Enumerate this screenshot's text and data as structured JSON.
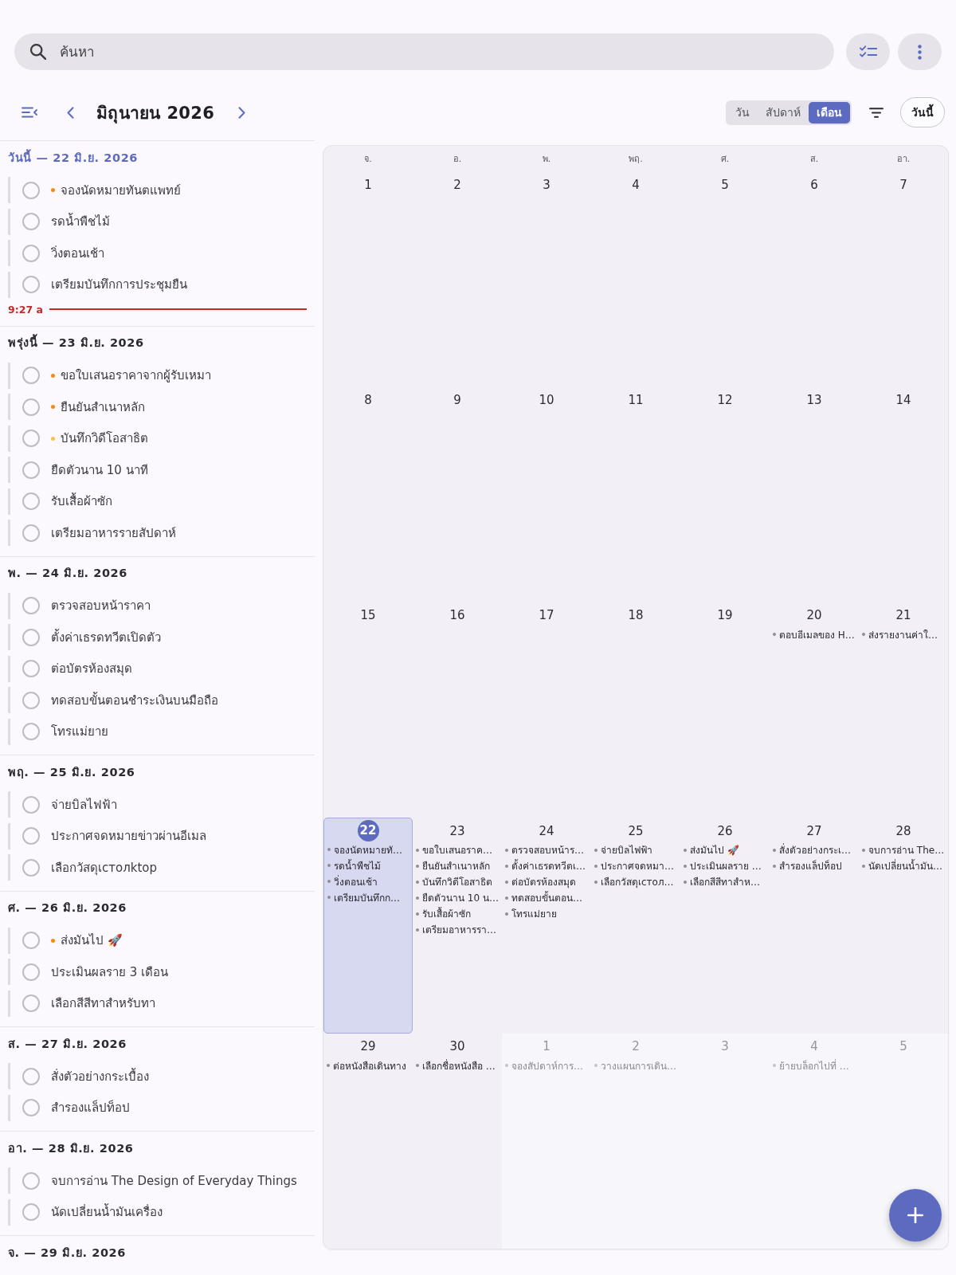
{
  "search": {
    "placeholder": "ค้นหา"
  },
  "toolbar": {
    "title": "มิถุนายน 2026",
    "view_tabs": [
      {
        "label": "วัน",
        "selected": false
      },
      {
        "label": "สัปดาห์",
        "selected": false
      },
      {
        "label": "เดือน",
        "selected": true
      }
    ],
    "today_button": "วันนี้"
  },
  "agenda": [
    {
      "heading": "วันนี้ — 22 มิ.ย. 2026",
      "today": true,
      "tasks": [
        {
          "title": "จองนัดหมายทันตแพทย์",
          "checked": false,
          "color": "#f28c0f"
        },
        {
          "title": "รดน้ำพืชไม้",
          "checked": false
        },
        {
          "title": "วิ่งตอนเช้า",
          "checked": false
        },
        {
          "title": "เตรียมบันทึกการประชุมยืน",
          "checked": false
        }
      ],
      "now_marker": "9:27 a"
    },
    {
      "heading": "พรุ่งนี้ — 23 มิ.ย. 2026",
      "today": false,
      "tasks": [
        {
          "title": "ขอใบเสนอราคาจากผู้รับเหมา",
          "checked": false,
          "color": "#f28c0f"
        },
        {
          "title": "ยืนยันสำเนาหลัก",
          "checked": false,
          "color": "#f28c0f"
        },
        {
          "title": "บันทึกวิดีโอสาธิต",
          "checked": false,
          "color": "#f6c342"
        },
        {
          "title": "ยืดตัวนาน 10 นาที",
          "checked": false
        },
        {
          "title": "รับเสื้อผ้าซัก",
          "checked": false
        },
        {
          "title": "เตรียมอาหารรายสัปดาห์",
          "checked": false
        }
      ]
    },
    {
      "heading": "พ. — 24 มิ.ย. 2026",
      "today": false,
      "tasks": [
        {
          "title": "ตรวจสอบหน้าราคา",
          "checked": false
        },
        {
          "title": "ตั้งค่าเธรดทวีตเปิดตัว",
          "checked": false
        },
        {
          "title": "ต่อบัตรห้องสมุด",
          "checked": false
        },
        {
          "title": "ทดสอบขั้นตอนชำระเงินบนมือถือ",
          "checked": false
        },
        {
          "title": "โทรแม่ยาย",
          "checked": false
        }
      ]
    },
    {
      "heading": "พฤ. — 25 มิ.ย. 2026",
      "today": false,
      "tasks": [
        {
          "title": "จ่ายบิลไฟฟ้า",
          "checked": false
        },
        {
          "title": "ประกาศจดหมายข่าวผ่านอีเมล",
          "checked": false
        },
        {
          "title": "เลือกวัสดุเстолktop",
          "checked": false
        }
      ]
    },
    {
      "heading": "ศ. — 26 มิ.ย. 2026",
      "today": false,
      "tasks": [
        {
          "title": "ส่งมันไป 🚀",
          "checked": false,
          "color": "#f28c0f"
        },
        {
          "title": "ประเมินผลราย 3 เดือน",
          "checked": false
        },
        {
          "title": "เลือกสีสีทาสำหรับทา",
          "checked": false
        }
      ]
    },
    {
      "heading": "ส. — 27 มิ.ย. 2026",
      "today": false,
      "tasks": [
        {
          "title": "สั่งตัวอย่างกระเบื้อง",
          "checked": false
        },
        {
          "title": "สำรองแล็ปท็อป",
          "checked": false
        }
      ]
    },
    {
      "heading": "อา. — 28 มิ.ย. 2026",
      "today": false,
      "tasks": [
        {
          "title": "จบการอ่าน The Design of Everyday Things",
          "checked": false
        },
        {
          "title": "นัดเปลี่ยนน้ำมันเครื่อง",
          "checked": false
        }
      ]
    },
    {
      "heading": "จ. — 29 มิ.ย. 2026",
      "today": false
    }
  ],
  "calendar": {
    "weekdays": [
      "จ.",
      "อ.",
      "พ.",
      "พฤ.",
      "ศ.",
      "ส.",
      "อา."
    ],
    "weeks": [
      {
        "days": [
          {
            "day": "1",
            "in_month": true,
            "selected": false,
            "today": false
          },
          {
            "day": "2",
            "in_month": true,
            "selected": false,
            "today": false
          },
          {
            "day": "3",
            "in_month": true,
            "selected": false,
            "today": false
          },
          {
            "day": "4",
            "in_month": true,
            "selected": false,
            "today": false
          },
          {
            "day": "5",
            "in_month": true,
            "selected": false,
            "today": false
          },
          {
            "day": "6",
            "in_month": true,
            "selected": false,
            "today": false
          },
          {
            "day": "7",
            "in_month": true,
            "selected": false,
            "today": false
          }
        ]
      },
      {
        "days": [
          {
            "day": "8",
            "in_month": true,
            "selected": false,
            "today": false
          },
          {
            "day": "9",
            "in_month": true,
            "selected": false,
            "today": false
          },
          {
            "day": "10",
            "in_month": true,
            "selected": false,
            "today": false
          },
          {
            "day": "11",
            "in_month": true,
            "selected": false,
            "today": false
          },
          {
            "day": "12",
            "in_month": true,
            "selected": false,
            "today": false
          },
          {
            "day": "13",
            "in_month": true,
            "selected": false,
            "today": false
          },
          {
            "day": "14",
            "in_month": true,
            "selected": false,
            "today": false
          }
        ]
      },
      {
        "days": [
          {
            "day": "15",
            "in_month": true,
            "selected": false,
            "today": false
          },
          {
            "day": "16",
            "in_month": true,
            "selected": false,
            "today": false
          },
          {
            "day": "17",
            "in_month": true,
            "selected": false,
            "today": false
          },
          {
            "day": "18",
            "in_month": true,
            "selected": false,
            "today": false
          },
          {
            "day": "19",
            "in_month": true,
            "selected": false,
            "today": false
          },
          {
            "day": "20",
            "in_month": true,
            "selected": false,
            "today": false,
            "events": [
              "ตอบอีเมลของ H…"
            ]
          },
          {
            "day": "21",
            "in_month": true,
            "selected": false,
            "today": false,
            "events": [
              "ส่งรายงานค่าใ…"
            ]
          }
        ]
      },
      {
        "days": [
          {
            "day": "22",
            "in_month": true,
            "selected": true,
            "today": true,
            "events": [
              "จองนัดหมายทั…",
              "รดน้ำพืชไม้",
              "วิ่งตอนเช้า",
              "เตรียมบันทึกก…"
            ]
          },
          {
            "day": "23",
            "in_month": true,
            "selected": false,
            "today": false,
            "events": [
              "ขอใบเสนอราค…",
              "ยืนยันสำเนาหลัก",
              "บันทึกวิดีโอสาธิต",
              "ยืดตัวนาน 10 น…",
              "รับเสื้อผ้าซัก",
              "เตรียมอาหารรา…"
            ]
          },
          {
            "day": "24",
            "in_month": true,
            "selected": false,
            "today": false,
            "events": [
              "ตรวจสอบหน้าร…",
              "ตั้งค่าเธรดทวีตเ…",
              "ต่อบัตรห้องสมุด",
              "ทดสอบขั้นตอน…",
              "โทรแม่ยาย"
            ]
          },
          {
            "day": "25",
            "in_month": true,
            "selected": false,
            "today": false,
            "events": [
              "จ่ายบิลไฟฟ้า",
              "ประกาศจดหมา…",
              "เลือกวัสดุเстол…"
            ]
          },
          {
            "day": "26",
            "in_month": true,
            "selected": false,
            "today": false,
            "events": [
              "ส่งมันไป 🚀",
              "ประเมินผลราย …",
              "เลือกสีสีทาสำห…"
            ]
          },
          {
            "day": "27",
            "in_month": true,
            "selected": false,
            "today": false,
            "events": [
              "สั่งตัวอย่างกระเ…",
              "สำรองแล็ปท็อป"
            ]
          },
          {
            "day": "28",
            "in_month": true,
            "selected": false,
            "today": false,
            "events": [
              "จบการอ่าน The…",
              "นัดเปลี่ยนน้ำมัน…"
            ]
          }
        ]
      },
      {
        "days": [
          {
            "day": "29",
            "in_month": true,
            "selected": false,
            "today": false,
            "events": [
              "ต่อหนังสือเดินทาง"
            ]
          },
          {
            "day": "30",
            "in_month": true,
            "selected": false,
            "today": false,
            "events": [
              "เลือกชื่อหนังสือ …"
            ]
          },
          {
            "day": "1",
            "in_month": false,
            "selected": false,
            "today": false,
            "events": [
              "จองสัปดาห์การ…"
            ]
          },
          {
            "day": "2",
            "in_month": false,
            "selected": false,
            "today": false,
            "events": [
              "วางแผนการเดิน…"
            ]
          },
          {
            "day": "3",
            "in_month": false,
            "selected": false,
            "today": false
          },
          {
            "day": "4",
            "in_month": false,
            "selected": false,
            "today": false,
            "events": [
              "ย้ายบล็อกไปที่ …"
            ]
          },
          {
            "day": "5",
            "in_month": false,
            "selected": false,
            "today": false
          }
        ]
      }
    ]
  }
}
